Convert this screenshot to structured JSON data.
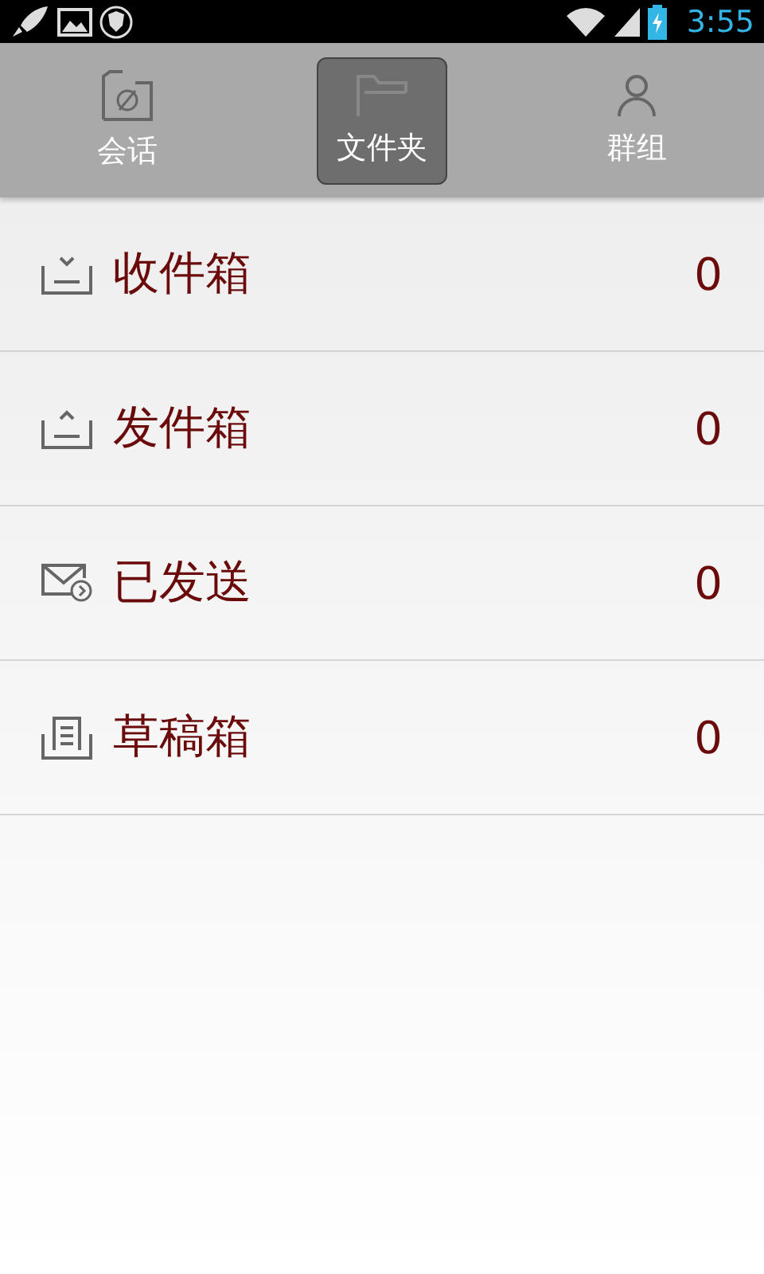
{
  "status_bar": {
    "time": "3:55"
  },
  "tabs": [
    {
      "label": "会话",
      "kind": "chat",
      "selected": false
    },
    {
      "label": "文件夹",
      "kind": "folder",
      "selected": true
    },
    {
      "label": "群组",
      "kind": "person",
      "selected": false
    }
  ],
  "folders": [
    {
      "name": "收件箱",
      "kind": "inbox",
      "count": "0"
    },
    {
      "name": "发件箱",
      "kind": "outbox",
      "count": "0"
    },
    {
      "name": "已发送",
      "kind": "sent",
      "count": "0"
    },
    {
      "name": "草稿箱",
      "kind": "drafts",
      "count": "0"
    }
  ]
}
